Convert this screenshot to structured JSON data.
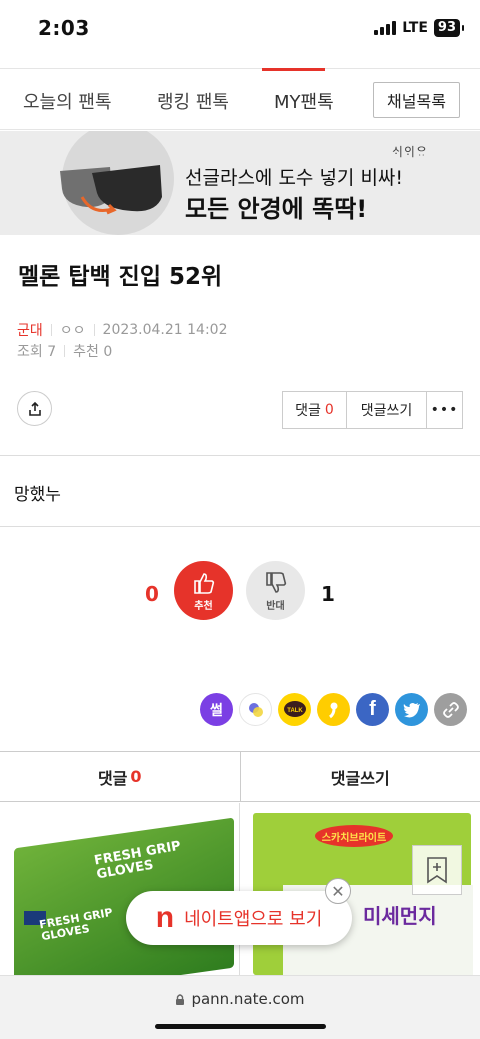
{
  "status": {
    "time": "2:03",
    "network": "LTE",
    "battery": "93"
  },
  "tabs": {
    "today": "오늘의 팬톡",
    "ranking": "랭킹 팬톡",
    "my": "MY팬톡",
    "channel_list": "채널목록"
  },
  "ad": {
    "brand": "ᄉᆡᄋᆡᄋᆢ",
    "line1": "선글라스에 도수 넣기 비싸!",
    "line2": "모든 안경에 똑딱!"
  },
  "post": {
    "title": "멜론 탑백 진입 52위",
    "category": "군대",
    "author": "ㅇㅇ",
    "date": "2023.04.21 14:02",
    "views": "조회 7",
    "recommends": "추천 0",
    "body": "망했누"
  },
  "actions": {
    "comment_label": "댓글",
    "comment_count": "0",
    "write_label": "댓글쓰기",
    "more": "•••"
  },
  "vote": {
    "up_count": "0",
    "up_label": "추천",
    "down_count": "1",
    "down_label": "반대"
  },
  "sns": {
    "ssul": "썰",
    "talk": "TALK",
    "fb": "f"
  },
  "comment_bar": {
    "comment_label": "댓글",
    "comment_count": "0",
    "write_label": "댓글쓰기"
  },
  "products": {
    "left_text1": "FRESH GRIP\nGLOVES",
    "left_text2": "FRESH GRIP\nGLOVES",
    "right_badge": "스카치브라이트",
    "right_title": "미세먼지"
  },
  "app_banner": {
    "logo": "n",
    "label": "네이트앱으로 보기"
  },
  "urlbar": {
    "url": "pann.nate.com"
  },
  "colors": {
    "accent": "#e6332a"
  }
}
